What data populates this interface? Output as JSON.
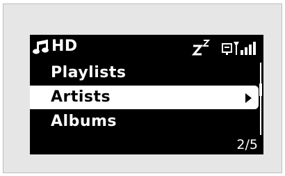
{
  "status_bar": {
    "source": "HD",
    "source_icon": "music-note-icon",
    "sleep_icon": "sleep-timer-icon",
    "signal_icon": "wireless-signal-icon"
  },
  "menu": {
    "items": [
      {
        "label": "Playlists",
        "selected": false
      },
      {
        "label": "Artists",
        "selected": true
      },
      {
        "label": "Albums",
        "selected": false
      }
    ],
    "page_indicator": "2/5"
  },
  "colors": {
    "screen_background": "#000000",
    "text": "#ffffff",
    "highlight": "#ffffff",
    "frame": "#e6e6e6"
  }
}
